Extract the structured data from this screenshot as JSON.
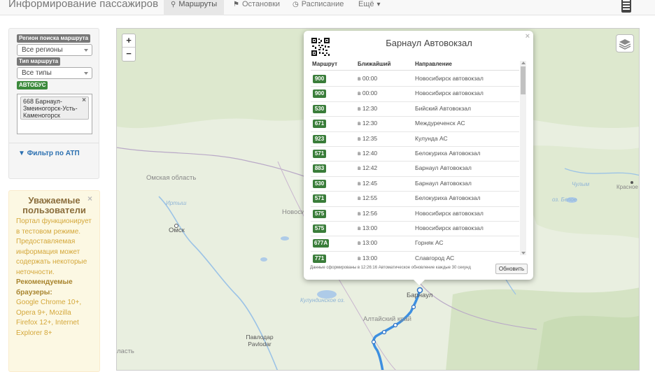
{
  "header": {
    "brand": "Информирование пассажиров",
    "tabs": [
      {
        "label": "Маршруты",
        "icon": "map-marker-icon",
        "active": true
      },
      {
        "label": "Остановки",
        "icon": "flag-icon",
        "active": false
      },
      {
        "label": "Расписание",
        "icon": "clock-icon",
        "active": false
      },
      {
        "label": "Ещё",
        "icon": "caret-down-icon",
        "active": false
      }
    ]
  },
  "filters": {
    "region_label": "Регион поиска маршрута",
    "region_value": "Все регионы",
    "type_label": "Тип маршрута",
    "type_value": "Все типы",
    "bus_badge": "АВТОБУС",
    "selected_route": "668 Барнаул-Змеиногорск-Усть-Каменогорск",
    "selected_route_remove": "×",
    "atp_filter": "Фильтр по АТП"
  },
  "notice": {
    "title": "Уважаемые пользователи",
    "close": "×",
    "text1": "Портал функционирует в тестовом режиме. Предоставляемая информация может содержать некоторые неточности.",
    "strong": "Рекомендуемые браузеры:",
    "text2": "Google Chrome 10+, Opera 9+, Mozilla Firefox 12+, Internet Explorer 8+"
  },
  "map": {
    "zoom_in": "+",
    "zoom_out": "−",
    "labels": {
      "omsk_region": "Омская область",
      "omsk": "Омск",
      "novosib": "Новосиб",
      "altai": "Алтайский край",
      "barnaul": "Барнаул",
      "kulunda": "Кулундинское оз.",
      "pavlodar": "Павлодар Pavlodar",
      "oblast": "ласть",
      "krasnoyarsk": "Красное",
      "belo": "оз. Белое",
      "chulym": "Чулым",
      "irtysh": "Иртыш"
    }
  },
  "popup": {
    "title": "Барнаул Автовокзал",
    "close": "×",
    "col_route": "Маршрут",
    "col_nearest": "Ближайший",
    "col_direction": "Направление",
    "rows": [
      {
        "route": "900",
        "time": "в 00:00",
        "dir": "Новосибирск автовокзал"
      },
      {
        "route": "900",
        "time": "в 00:00",
        "dir": "Новосибирск автовокзал"
      },
      {
        "route": "530",
        "time": "в 12:30",
        "dir": "Бийский Автовокзал"
      },
      {
        "route": "671",
        "time": "в 12:30",
        "dir": "Междуреченск АС"
      },
      {
        "route": "923",
        "time": "в 12:35",
        "dir": "Кулунда АС"
      },
      {
        "route": "571",
        "time": "в 12:40",
        "dir": "Белокуриха Автовокзал"
      },
      {
        "route": "883",
        "time": "в 12:42",
        "dir": "Барнаул Автовокзал"
      },
      {
        "route": "530",
        "time": "в 12:45",
        "dir": "Барнаул Автовокзал"
      },
      {
        "route": "571",
        "time": "в 12:55",
        "dir": "Белокуриха Автовокзал"
      },
      {
        "route": "575",
        "time": "в 12:56",
        "dir": "Новосибирск автовокзал"
      },
      {
        "route": "575",
        "time": "в 13:00",
        "dir": "Новосибирск автовокзал"
      },
      {
        "route": "677А",
        "time": "в 13:00",
        "dir": "Горняк АС"
      },
      {
        "route": "771",
        "time": "в 13:00",
        "dir": "Славгород АС"
      }
    ],
    "footnote": "Данные сформированы в 12:26:16 Автоматическое обновление каждые 30 секунд",
    "refresh": "Обновить"
  }
}
